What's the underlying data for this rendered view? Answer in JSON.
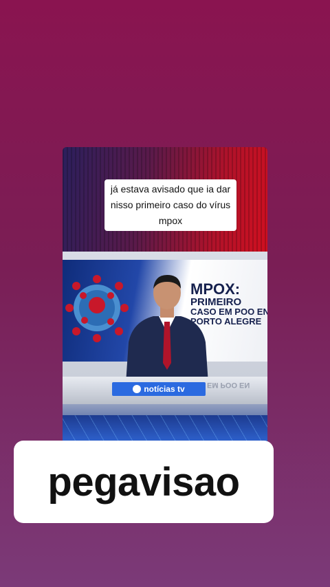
{
  "story": {
    "caption": "já estava avisado que ia dar nisso primeiro caso do vírus mpox",
    "news": {
      "headline_1": "MPOX:",
      "headline_2": "PRIMEIRO",
      "headline_3": "CASO EM POO EN",
      "headline_4": "PORTO ALEGRE",
      "channel_logo": "notícias tv",
      "desk_reflection": "EM POO EN"
    },
    "username": "pegavisao"
  }
}
